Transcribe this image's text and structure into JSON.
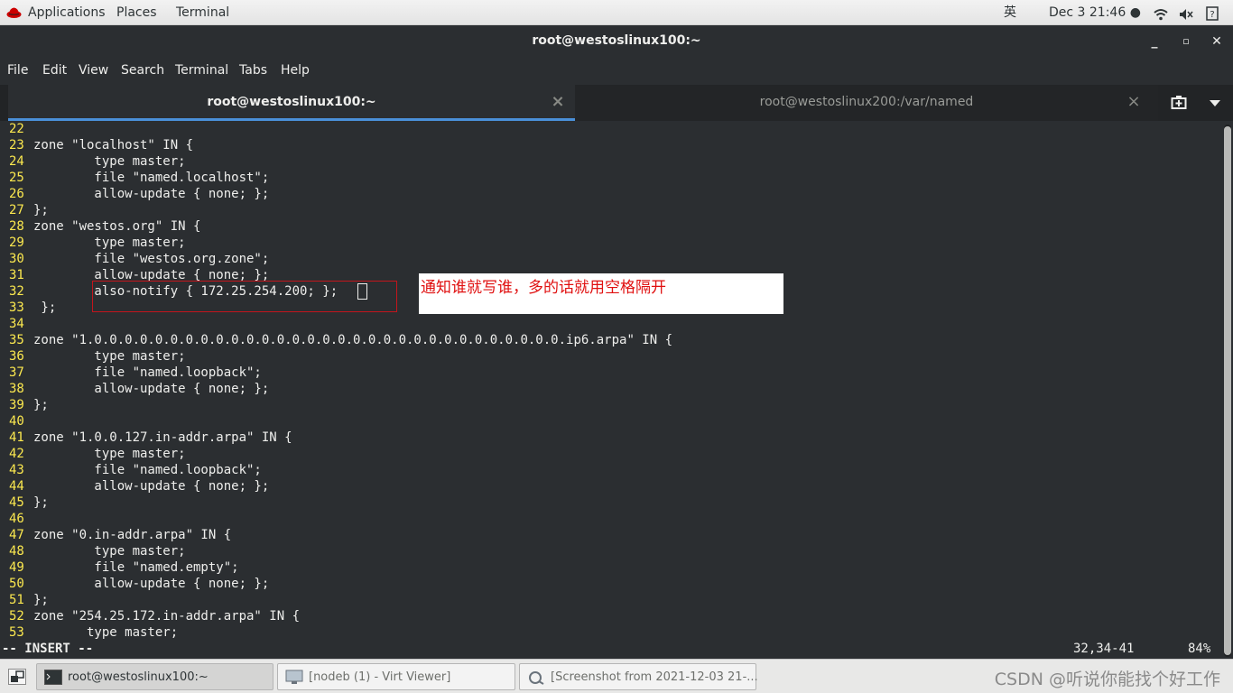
{
  "topbar": {
    "applications": "Applications",
    "places": "Places",
    "terminal": "Terminal",
    "input_method": "英",
    "datetime": "Dec 3  21:46 ●"
  },
  "window": {
    "title": "root@westoslinux100:~",
    "minimize": "_",
    "maximize": "▫",
    "close": "✕"
  },
  "menubar": [
    "File",
    "Edit",
    "View",
    "Search",
    "Terminal",
    "Tabs",
    "Help"
  ],
  "tabs": [
    {
      "label": "root@westoslinux100:~",
      "close": "×"
    },
    {
      "label": "root@westoslinux200:/var/named",
      "close": "×"
    }
  ],
  "editor": {
    "lines": [
      {
        "n": "22",
        "text": ""
      },
      {
        "n": "23",
        "text": "zone \"localhost\" IN {"
      },
      {
        "n": "24",
        "text": "        type master;"
      },
      {
        "n": "25",
        "text": "        file \"named.localhost\";"
      },
      {
        "n": "26",
        "text": "        allow-update { none; };"
      },
      {
        "n": "27",
        "text": "};"
      },
      {
        "n": "28",
        "text": "zone \"westos.org\" IN {"
      },
      {
        "n": "29",
        "text": "        type master;"
      },
      {
        "n": "30",
        "text": "        file \"westos.org.zone\";"
      },
      {
        "n": "31",
        "text": "        allow-update { none; };"
      },
      {
        "n": "32",
        "text": "        also-notify { 172.25.254.200; };"
      },
      {
        "n": "33",
        "text": " };"
      },
      {
        "n": "34",
        "text": ""
      },
      {
        "n": "35",
        "text": "zone \"1.0.0.0.0.0.0.0.0.0.0.0.0.0.0.0.0.0.0.0.0.0.0.0.0.0.0.0.0.0.0.0.ip6.arpa\" IN {"
      },
      {
        "n": "36",
        "text": "        type master;"
      },
      {
        "n": "37",
        "text": "        file \"named.loopback\";"
      },
      {
        "n": "38",
        "text": "        allow-update { none; };"
      },
      {
        "n": "39",
        "text": "};"
      },
      {
        "n": "40",
        "text": ""
      },
      {
        "n": "41",
        "text": "zone \"1.0.0.127.in-addr.arpa\" IN {"
      },
      {
        "n": "42",
        "text": "        type master;"
      },
      {
        "n": "43",
        "text": "        file \"named.loopback\";"
      },
      {
        "n": "44",
        "text": "        allow-update { none; };"
      },
      {
        "n": "45",
        "text": "};"
      },
      {
        "n": "46",
        "text": ""
      },
      {
        "n": "47",
        "text": "zone \"0.in-addr.arpa\" IN {"
      },
      {
        "n": "48",
        "text": "        type master;"
      },
      {
        "n": "49",
        "text": "        file \"named.empty\";"
      },
      {
        "n": "50",
        "text": "        allow-update { none; };"
      },
      {
        "n": "51",
        "text": "};"
      },
      {
        "n": "52",
        "text": "zone \"254.25.172.in-addr.arpa\" IN {"
      },
      {
        "n": "53",
        "text": "       type master;"
      }
    ],
    "mode": "-- INSERT --",
    "position": "32,34-41",
    "percent": "84%"
  },
  "annotation": {
    "note": "通知谁就写谁，多的话就用空格隔开",
    "color": "#e01010"
  },
  "taskbar": {
    "items": [
      {
        "label": "root@westoslinux100:~"
      },
      {
        "label": "[nodeb (1) - Virt Viewer]"
      },
      {
        "label": "[Screenshot from 2021-12-03 21-..."
      }
    ],
    "watermark": "CSDN @听说你能找个好工作"
  },
  "colors": {
    "terminal_bg": "#2b2e31",
    "line_number": "#fce94f",
    "tab_accent": "#4a90d9"
  }
}
